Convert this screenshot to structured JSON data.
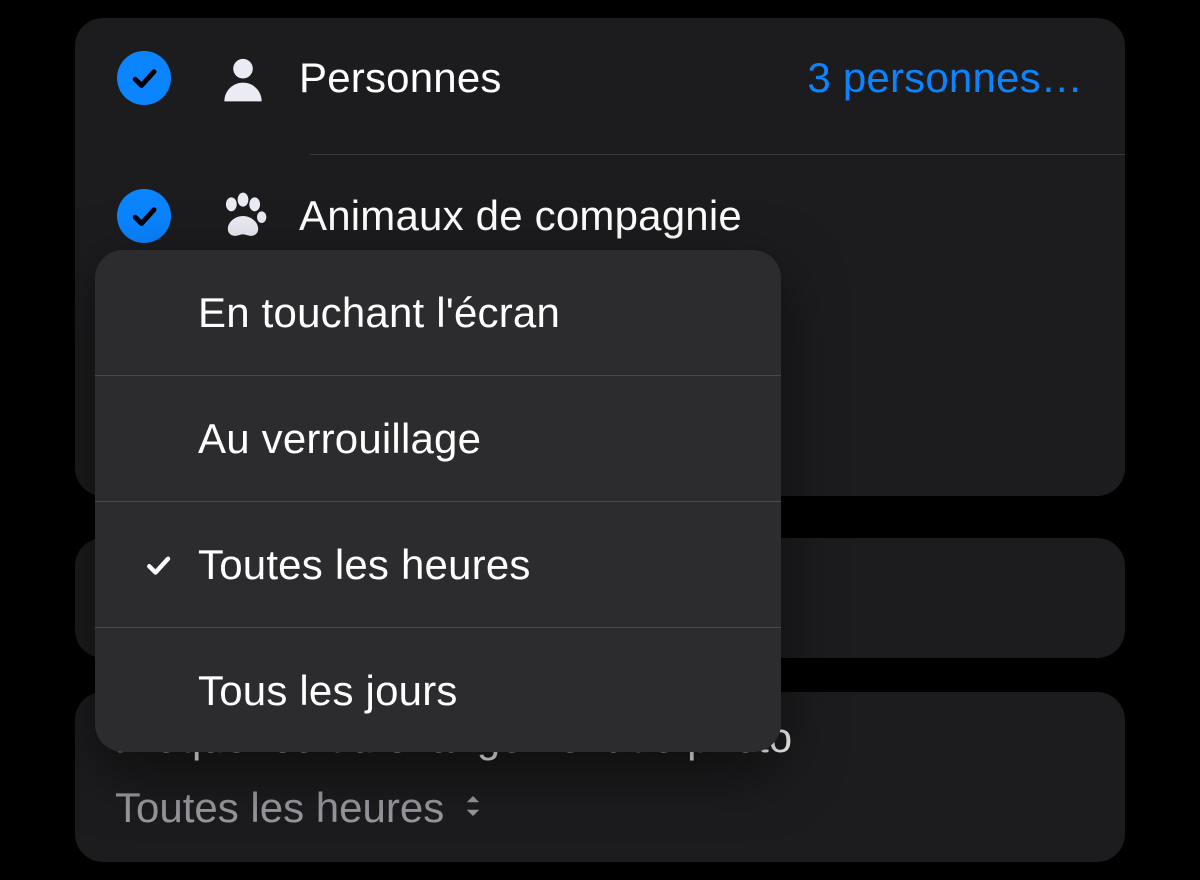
{
  "filters": {
    "personnes": {
      "label": "Personnes",
      "value": "3 personnes…",
      "checked": true
    },
    "animaux": {
      "label": "Animaux de compagnie",
      "checked": true
    }
  },
  "frequency": {
    "title": "Fréquence du changement de photo",
    "current_value": "Toutes les heures",
    "options": [
      {
        "label": "En touchant l'écran",
        "selected": false
      },
      {
        "label": "Au verrouillage",
        "selected": false
      },
      {
        "label": "Toutes les heures",
        "selected": true
      },
      {
        "label": "Tous les jours",
        "selected": false
      }
    ]
  }
}
